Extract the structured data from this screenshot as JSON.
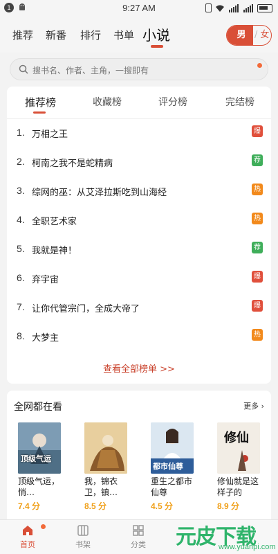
{
  "status_bar": {
    "notification_count": "1",
    "time": "9:27 AM"
  },
  "top_nav": {
    "tabs": [
      {
        "label": "推荐"
      },
      {
        "label": "新番"
      },
      {
        "label": "排行"
      },
      {
        "label": "书单"
      },
      {
        "label": "小说",
        "active": true
      }
    ],
    "gender_toggle": {
      "male": "男",
      "separator": "/",
      "female": "女",
      "selected": "男"
    }
  },
  "search": {
    "placeholder": "搜书名、作者、主角，一搜即有"
  },
  "ranking": {
    "tabs": [
      {
        "label": "推荐榜",
        "active": true
      },
      {
        "label": "收藏榜"
      },
      {
        "label": "评分榜"
      },
      {
        "label": "完结榜"
      }
    ],
    "items": [
      {
        "rank": "1.",
        "title": "万相之王",
        "badge": "爆",
        "badge_color": "#e0503c"
      },
      {
        "rank": "2.",
        "title": "柯南之我不是蛇精病",
        "badge": "荐",
        "badge_color": "#3fae5a"
      },
      {
        "rank": "3.",
        "title": "综网的巫：从艾泽拉斯吃到山海经",
        "badge": "热",
        "badge_color": "#f28a1c"
      },
      {
        "rank": "4.",
        "title": "全职艺术家",
        "badge": "热",
        "badge_color": "#f28a1c"
      },
      {
        "rank": "5.",
        "title": "我就是神！",
        "badge": "荐",
        "badge_color": "#3fae5a"
      },
      {
        "rank": "6.",
        "title": "弃宇宙",
        "badge": "爆",
        "badge_color": "#e0503c"
      },
      {
        "rank": "7.",
        "title": "让你代管宗门，全成大帝了",
        "badge": "爆",
        "badge_color": "#e0503c"
      },
      {
        "rank": "8.",
        "title": "大梦主",
        "badge": "热",
        "badge_color": "#f28a1c"
      }
    ],
    "see_all": "查看全部榜单 >>"
  },
  "watching": {
    "heading": "全网都在看",
    "more": "更多",
    "books": [
      {
        "title": "顶级气运，悄…",
        "score": "7.4 分",
        "cover_text": "顶级气运",
        "cover_bg": "#6f8fa8"
      },
      {
        "title": "我，锦衣卫，镇…",
        "score": "8.5 分",
        "cover_text": "",
        "cover_bg": "#d9b27a"
      },
      {
        "title": "重生之都市仙尊",
        "score": "4.5 分",
        "cover_text": "都市仙尊",
        "cover_bg": "#cfe0ee"
      },
      {
        "title": "修仙就是这样子的",
        "score": "8.9 分",
        "cover_text": "修仙",
        "cover_bg": "#f1ece4"
      }
    ]
  },
  "bottom_nav": {
    "items": [
      {
        "label": "首页",
        "icon": "home-icon",
        "active": true
      },
      {
        "label": "书架",
        "icon": "bookshelf-icon"
      },
      {
        "label": "分类",
        "icon": "category-icon"
      }
    ]
  },
  "watermark": {
    "text": "元皮下载",
    "url": "www.yuanpi.com"
  },
  "colors": {
    "accent": "#d94f37",
    "score": "#f0a01a",
    "watermark": "#2fb46b"
  }
}
